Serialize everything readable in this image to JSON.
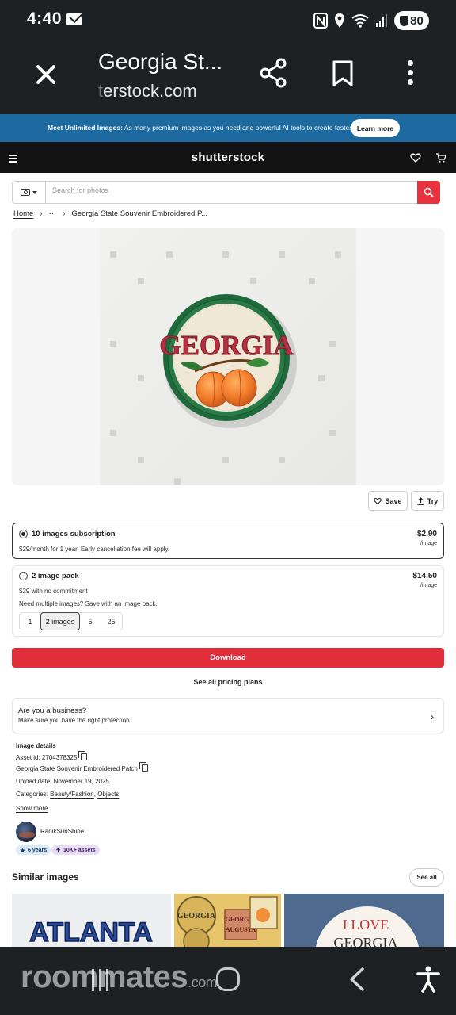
{
  "status_bar": {
    "time": "4:40",
    "battery": "80"
  },
  "tab": {
    "title": "Georgia St...",
    "url_faded": "t",
    "url": "erstock.com"
  },
  "promo": {
    "bold": "Meet Unlimited Images:",
    "text": " As many premium images as you need and powerful AI tools to create faster.",
    "button": "Learn more"
  },
  "header": {
    "logo": "shutterstock"
  },
  "search": {
    "placeholder": "Search for photos"
  },
  "breadcrumb": {
    "home": "Home",
    "ellipsis": "···",
    "current": "Georgia State Souvenir Embroidered P..."
  },
  "image": {
    "patch_text": "GEORGIA"
  },
  "actions": {
    "save": "Save",
    "try": "Try"
  },
  "plans": [
    {
      "title": "10 images subscription",
      "desc": "$29/month for 1 year. Early cancellation fee will apply.",
      "price": "$2.90",
      "per": "/image",
      "selected": true
    },
    {
      "title": "2 image pack",
      "desc": "$29 with no commitment",
      "desc2": "Need multiple images? Save with an image pack.",
      "price": "$14.50",
      "per": "/image",
      "selected": false
    }
  ],
  "pack_options": [
    "1",
    "2 images",
    "5",
    "25"
  ],
  "download": "Download",
  "pricing_link": "See all pricing plans",
  "business": {
    "title": "Are you a business?",
    "subtitle": "Make sure you have the right protection"
  },
  "details": {
    "heading": "Image details",
    "asset_id": "Asset id: 2704378325",
    "name": "Georgia State Souvenir Embroidered Patch",
    "upload_date": "Upload date: November 19, 2025",
    "categories_label": "Categories: ",
    "category1": "Beauty/Fashion",
    "category_sep": ", ",
    "category2": "Objects",
    "show_more": "Show more"
  },
  "author": {
    "name": "RadikSunShine",
    "badge_years": "6 years",
    "badge_assets": "10K+ assets"
  },
  "similar": {
    "title": "Similar images",
    "see_all": "See all",
    "thumb1_text": "ATLANTA",
    "thumb2_text1": "GEORGIA",
    "thumb2_text2": "GEORGIA",
    "thumb2_text3": "AUGUSTA",
    "thumb3_text1": "I LOVE",
    "thumb3_text2": "GEORGIA"
  },
  "navbar": {
    "watermark": "roommates",
    "watermark_suffix": ".com"
  },
  "colors": {
    "brand_red": "#e22d3a",
    "promo_blue": "#1c6aa0",
    "dark": "#1e2124"
  }
}
